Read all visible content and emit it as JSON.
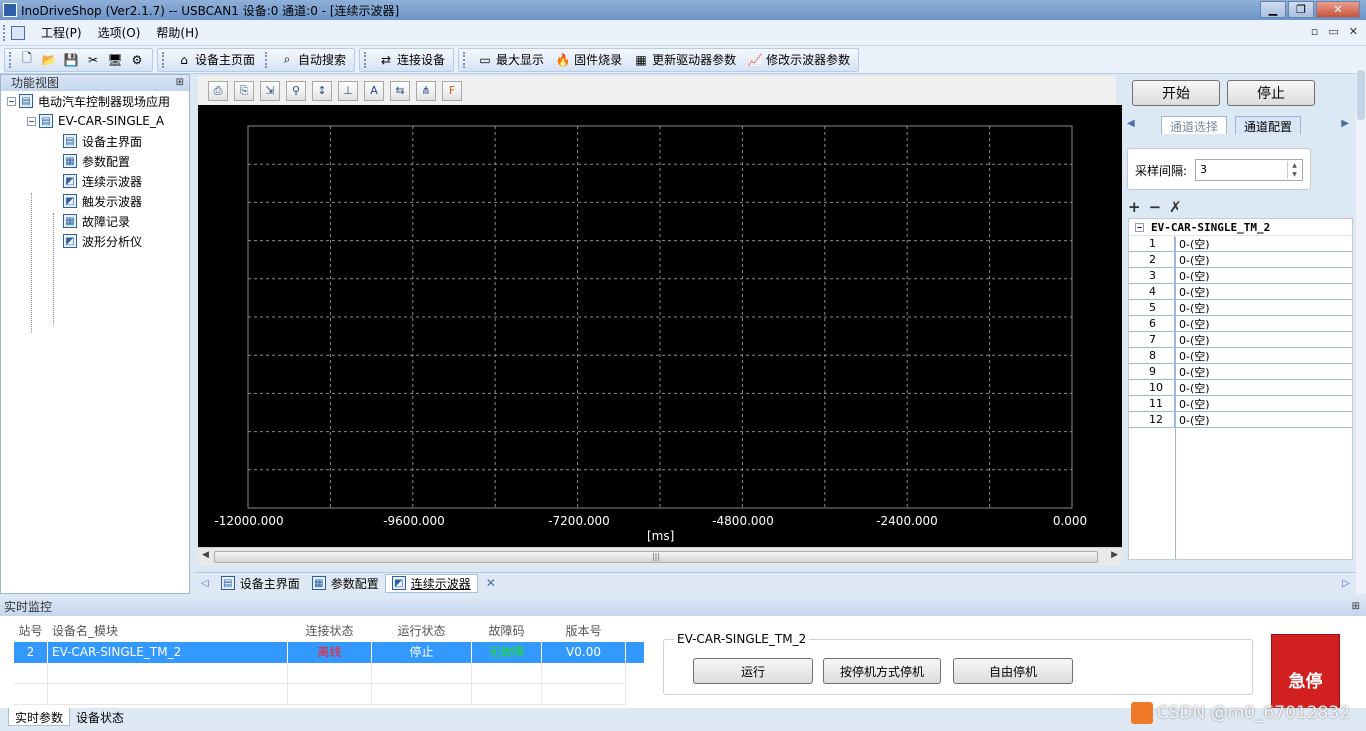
{
  "window": {
    "title": "InoDriveShop (Ver2.1.7) -- USBCAN1 设备:0 通道:0 - [连续示波器]"
  },
  "menu": {
    "items": [
      "工程(P)",
      "选项(O)",
      "帮助(H)"
    ]
  },
  "toolbar": {
    "device_home": "设备主页面",
    "auto_search": "自动搜索",
    "connect_device": "连接设备",
    "maximize": "最大显示",
    "firmware_burn": "固件烧录",
    "update_driver_params": "更新驱动器参数",
    "modify_scope_params": "修改示波器参数"
  },
  "left_panel": {
    "title": "功能视图",
    "root": "电动汽车控制器现场应用",
    "device": "EV-CAR-SINGLE_A",
    "items": [
      {
        "label": "设备主界面",
        "icon": "device-icon"
      },
      {
        "label": "参数配置",
        "icon": "grid-icon"
      },
      {
        "label": "连续示波器",
        "icon": "scope-icon"
      },
      {
        "label": "触发示波器",
        "icon": "scope-icon"
      },
      {
        "label": "故障记录",
        "icon": "grid-icon"
      },
      {
        "label": "波形分析仪",
        "icon": "scope-icon"
      }
    ]
  },
  "scope": {
    "x_ticks": [
      "-12000.000",
      "-9600.000",
      "-7200.000",
      "-4800.000",
      "-2400.000",
      "0.000"
    ],
    "x_unit": "[ms]",
    "grid_color": "#8a8a8a",
    "background": "#000000"
  },
  "right_panel": {
    "start": "开始",
    "stop": "停止",
    "tab_channel_select": "通道选择",
    "tab_channel_config": "通道配置",
    "sample_interval_label": "采样间隔:",
    "sample_interval_value": "3",
    "device_node": "EV-CAR-SINGLE_TM_2",
    "channels": [
      {
        "num": "1",
        "value": "0-(空)"
      },
      {
        "num": "2",
        "value": "0-(空)"
      },
      {
        "num": "3",
        "value": "0-(空)"
      },
      {
        "num": "4",
        "value": "0-(空)"
      },
      {
        "num": "5",
        "value": "0-(空)"
      },
      {
        "num": "6",
        "value": "0-(空)"
      },
      {
        "num": "7",
        "value": "0-(空)"
      },
      {
        "num": "8",
        "value": "0-(空)"
      },
      {
        "num": "9",
        "value": "0-(空)"
      },
      {
        "num": "10",
        "value": "0-(空)"
      },
      {
        "num": "11",
        "value": "0-(空)"
      },
      {
        "num": "12",
        "value": "0-(空)"
      }
    ]
  },
  "doc_tabs": [
    {
      "label": "设备主界面"
    },
    {
      "label": "参数配置"
    },
    {
      "label": "连续示波器"
    }
  ],
  "monitor": {
    "title": "实时监控",
    "headers": [
      "站号",
      "设备名_模块",
      "连接状态",
      "运行状态",
      "故障码",
      "版本号"
    ],
    "rows": [
      {
        "station": "2",
        "name": "EV-CAR-SINGLE_TM_2",
        "conn": "离线",
        "run": "停止",
        "fault": "无故障",
        "version": "V0.00"
      }
    ],
    "conn_color": "#ff2020",
    "fault_color": "#22dd22",
    "group_title": "EV-CAR-SINGLE_TM_2",
    "btn_run": "运行",
    "btn_stop_mode": "按停机方式停机",
    "btn_free_stop": "自由停机",
    "estop": "急停"
  },
  "bottom_tabs": [
    "实时参数",
    "设备状态"
  ],
  "watermark": "CSDN @m0_67012832"
}
